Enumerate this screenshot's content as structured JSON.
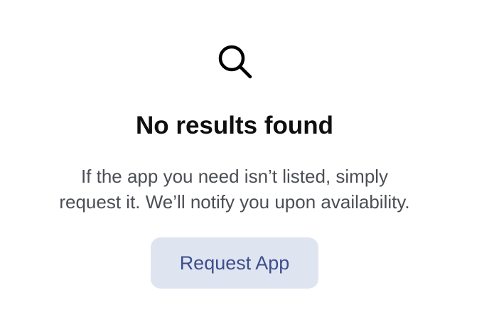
{
  "empty_state": {
    "icon": "search-icon",
    "title": "No results found",
    "description_line1": "If the app you need isn’t listed, simply",
    "description_line2": "request it. We’ll notify you upon availability.",
    "button_label": "Request App"
  },
  "colors": {
    "title": "#0f0f10",
    "description": "#4b4e54",
    "button_background": "#dfe4f1",
    "button_text": "#3d4f8c"
  }
}
